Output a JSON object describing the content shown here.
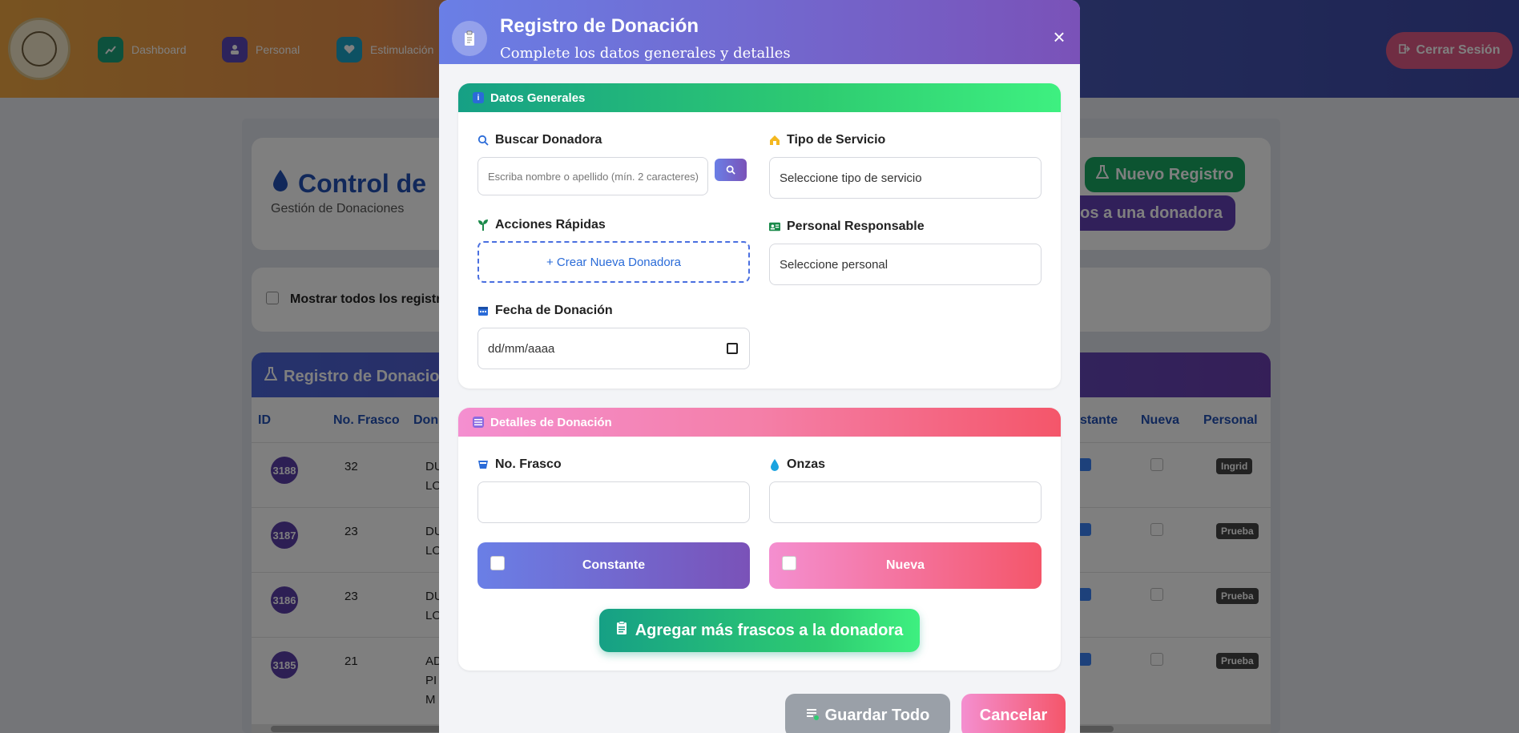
{
  "nav": {
    "items": [
      {
        "label": "Dashboard",
        "icon": "chart-icon",
        "color": "#1aa37a"
      },
      {
        "label": "Personal",
        "icon": "user-icon",
        "color": "#5a46b8"
      },
      {
        "label": "Estimulación",
        "icon": "heart-icon",
        "color": "#1aa3c7"
      }
    ],
    "logout_label": "Cerrar Sesión"
  },
  "page": {
    "title": "Control de",
    "subtitle": "Gestión de Donaciones",
    "new_record_label": "Nuevo Registro",
    "add_bottles_label": "cos a una donadora",
    "show_all_label": "Mostrar todos los registr",
    "table_title": "Registro de Donacio"
  },
  "table": {
    "headers": {
      "id": "ID",
      "frasco": "No. Frasco",
      "donadora": "Don",
      "constante": "stante",
      "nueva": "Nueva",
      "personal": "Personal"
    },
    "rows": [
      {
        "id": "3188",
        "frasco": "32",
        "name1": "DU",
        "name2": "LO",
        "name3": "",
        "constante": true,
        "nueva": false,
        "personal": "Ingrid"
      },
      {
        "id": "3187",
        "frasco": "23",
        "name1": "DU",
        "name2": "LO",
        "name3": "",
        "constante": true,
        "nueva": false,
        "personal": "Prueba"
      },
      {
        "id": "3186",
        "frasco": "23",
        "name1": "DU",
        "name2": "LO",
        "name3": "",
        "constante": true,
        "nueva": false,
        "personal": "Prueba"
      },
      {
        "id": "3185",
        "frasco": "21",
        "name1": "AD",
        "name2": "PI",
        "name3": "M",
        "constante": true,
        "nueva": false,
        "personal": "Prueba"
      }
    ]
  },
  "modal": {
    "title": "Registro de Donación",
    "subtitle": "Complete los datos generales y detalles",
    "close_symbol": "×",
    "general": {
      "heading": "Datos Generales",
      "search_label": "Buscar Donadora",
      "search_placeholder": "Escriba nombre o apellido (mín. 2 caracteres)",
      "quick_actions_label": "Acciones Rápidas",
      "create_donor_label": "+ Crear Nueva Donadora",
      "date_label": "Fecha de Donación",
      "date_placeholder": "dd/mm/aaaa",
      "service_type_label": "Tipo de Servicio",
      "service_type_value": "Seleccione tipo de servicio",
      "staff_label": "Personal Responsable",
      "staff_value": "Seleccione personal"
    },
    "details": {
      "heading": "Detalles de Donación",
      "bottle_no_label": "No. Frasco",
      "ounces_label": "Onzas",
      "constant_label": "Constante",
      "new_label": "Nueva",
      "add_more_label": "Agregar más frascos a la donadora"
    },
    "footer": {
      "save_label": "Guardar Todo",
      "cancel_label": "Cancelar"
    }
  },
  "colors": {
    "header_gradient_start": "#6a7fe6",
    "header_gradient_end": "#7a52b8",
    "green_accent": "#2ecc71",
    "pink_accent": "#f4566a",
    "link_blue": "#2a6bd8"
  }
}
